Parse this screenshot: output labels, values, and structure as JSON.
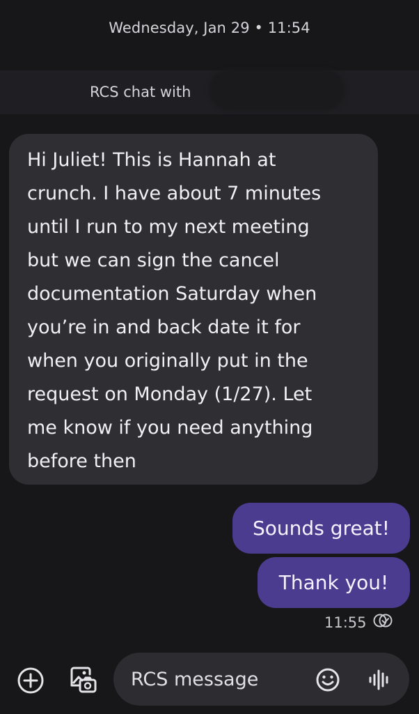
{
  "conversation": {
    "date_header": "Wednesday, Jan 29 • 11:54",
    "rcs_banner_label": "RCS chat with"
  },
  "messages": {
    "incoming": {
      "lines": [
        "Hi Juliet! This is Hannah at",
        "crunch. I have about 7 minutes",
        "until I run to my next meeting",
        "but we can sign the cancel",
        "documentation Saturday when",
        "you’re in and back date it for",
        "when you originally put in the",
        "request on Monday (1/27). Let",
        "me know if you need anything",
        "before then"
      ]
    },
    "outgoing": [
      {
        "text": "Sounds great!"
      },
      {
        "text": "Thank you!"
      }
    ],
    "last_timestamp": "11:55",
    "status_icon": "read-receipt-icon"
  },
  "composer": {
    "placeholder": "RCS message",
    "value": "",
    "icons": [
      "add-icon",
      "gallery-icon",
      "emoji-icon",
      "voice-icon"
    ]
  },
  "colors": {
    "background": "#17171a",
    "incoming_bubble": "#2e2e33",
    "outgoing_bubble": "#4b3c8f",
    "composer": "#2c2c31"
  }
}
